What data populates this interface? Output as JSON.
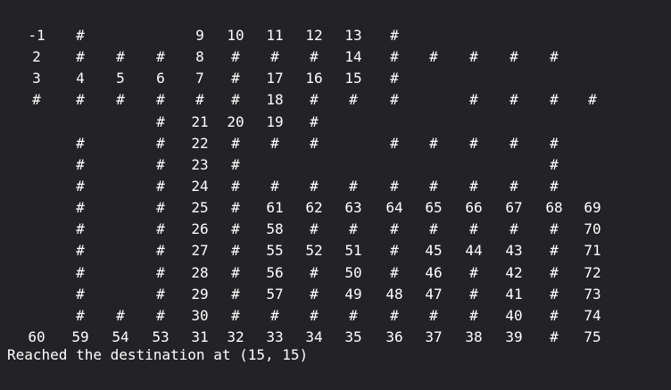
{
  "terminal": {
    "grid": [
      [
        "-1",
        "#",
        "",
        "",
        "9",
        "10",
        "11",
        "12",
        "13",
        "#",
        "",
        "",
        "",
        "",
        ""
      ],
      [
        "2",
        "#",
        "#",
        "#",
        "8",
        "#",
        "#",
        "#",
        "14",
        "#",
        "#",
        "#",
        "#",
        "#",
        ""
      ],
      [
        "3",
        "4",
        "5",
        "6",
        "7",
        "#",
        "17",
        "16",
        "15",
        "#",
        "",
        "",
        "",
        "",
        ""
      ],
      [
        "#",
        "#",
        "#",
        "#",
        "#",
        "#",
        "18",
        "#",
        "#",
        "#",
        "",
        "#",
        "#",
        "#",
        "#"
      ],
      [
        "",
        "",
        "",
        "#",
        "21",
        "20",
        "19",
        "#",
        "",
        "",
        "",
        "",
        "",
        "",
        ""
      ],
      [
        "",
        "#",
        "",
        "#",
        "22",
        "#",
        "#",
        "#",
        "",
        "#",
        "#",
        "#",
        "#",
        "#",
        ""
      ],
      [
        "",
        "#",
        "",
        "#",
        "23",
        "#",
        "",
        "",
        "",
        "",
        "",
        "",
        "",
        "#",
        ""
      ],
      [
        "",
        "#",
        "",
        "#",
        "24",
        "#",
        "#",
        "#",
        "#",
        "#",
        "#",
        "#",
        "#",
        "#",
        ""
      ],
      [
        "",
        "#",
        "",
        "#",
        "25",
        "#",
        "61",
        "62",
        "63",
        "64",
        "65",
        "66",
        "67",
        "68",
        "69"
      ],
      [
        "",
        "#",
        "",
        "#",
        "26",
        "#",
        "58",
        "#",
        "#",
        "#",
        "#",
        "#",
        "#",
        "#",
        "70"
      ],
      [
        "",
        "#",
        "",
        "#",
        "27",
        "#",
        "55",
        "52",
        "51",
        "#",
        "45",
        "44",
        "43",
        "#",
        "71"
      ],
      [
        "",
        "#",
        "",
        "#",
        "28",
        "#",
        "56",
        "#",
        "50",
        "#",
        "46",
        "#",
        "42",
        "#",
        "72"
      ],
      [
        "",
        "#",
        "",
        "#",
        "29",
        "#",
        "57",
        "#",
        "49",
        "48",
        "47",
        "#",
        "41",
        "#",
        "73"
      ],
      [
        "",
        "#",
        "#",
        "#",
        "30",
        "#",
        "#",
        "#",
        "#",
        "#",
        "#",
        "#",
        "40",
        "#",
        "74"
      ],
      [
        "60",
        "59",
        "54",
        "53",
        "31",
        "32",
        "33",
        "34",
        "35",
        "36",
        "37",
        "38",
        "39",
        "#",
        "75"
      ]
    ],
    "status_line": "Reached the destination at (15, 15)"
  },
  "colors": {
    "background": "#232226",
    "foreground": "#ffffff"
  }
}
